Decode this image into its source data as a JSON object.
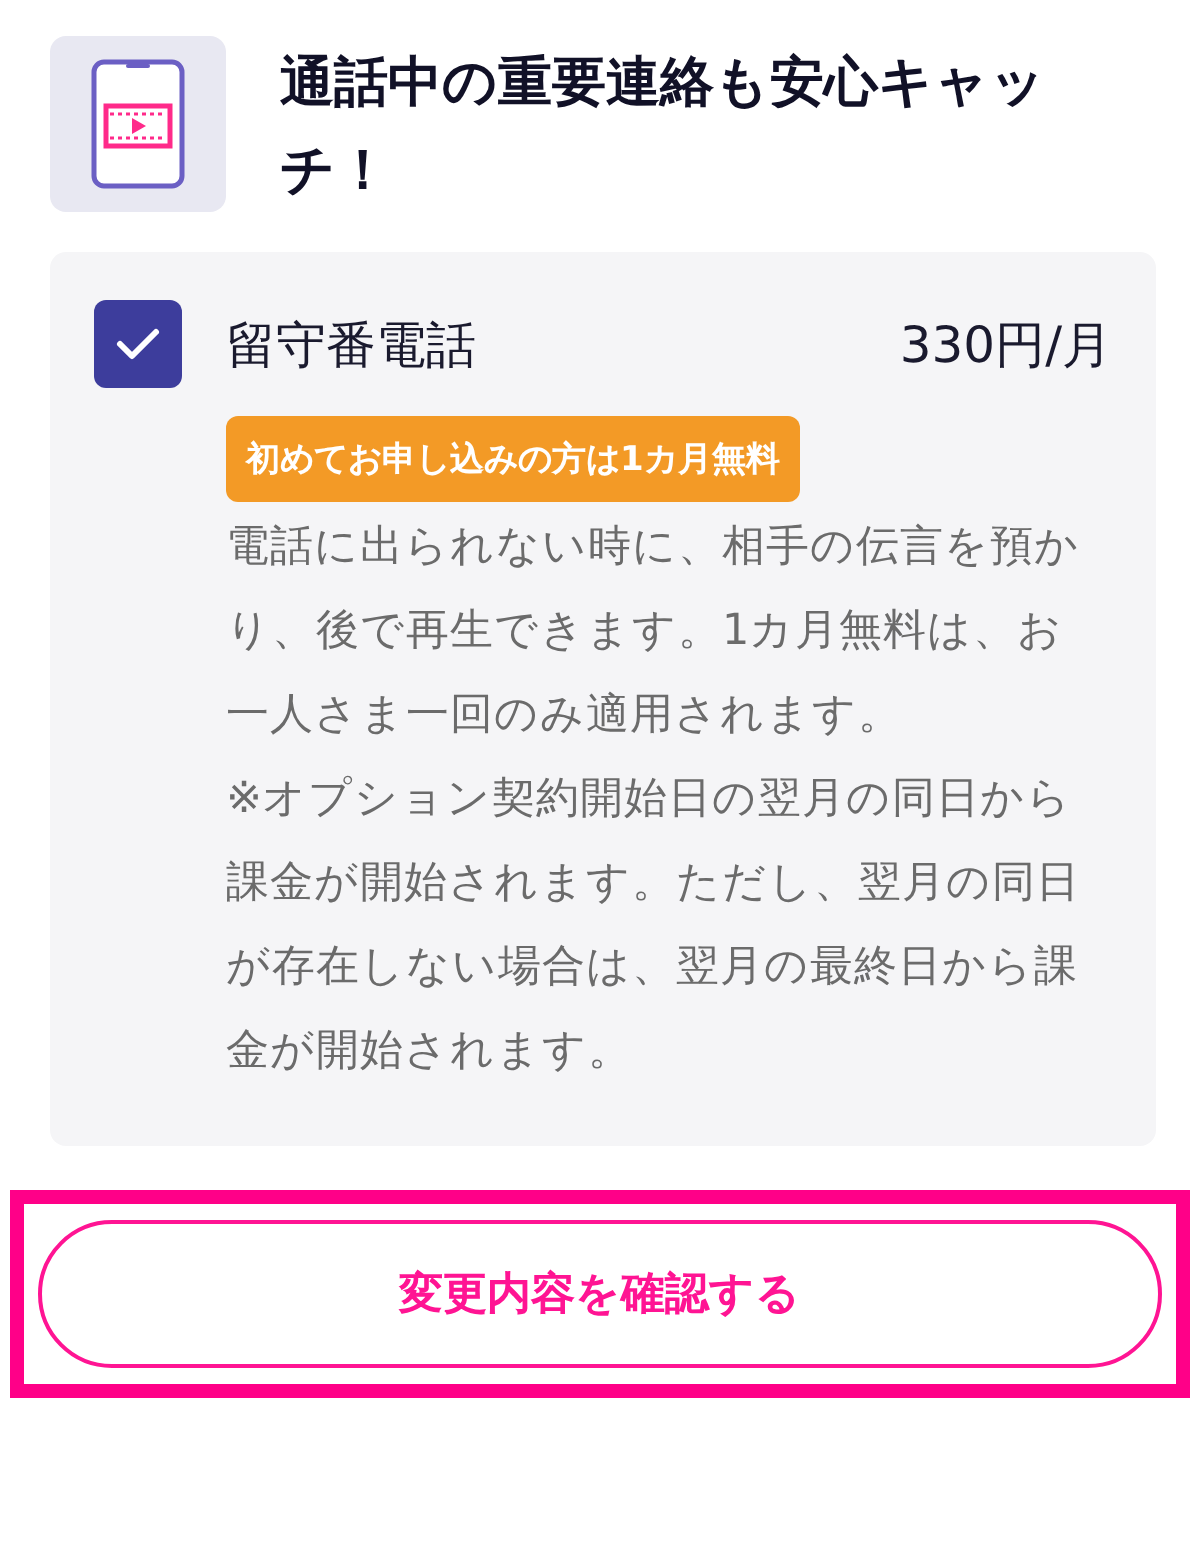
{
  "header": {
    "title": "通話中の重要連絡も安心キャッチ！"
  },
  "option": {
    "checked": true,
    "name": "留守番電話",
    "price": "330円/月",
    "badge": "初めてお申し込みの方は1カ月無料",
    "paragraphs": [
      "電話に出られない時に、相手の伝言を預かり、後で再生できます。1カ月無料は、お一人さま一回のみ適用されます。",
      "※オプション契約開始日の翌月の同日から課金が開始されます。ただし、翌月の同日が存在しない場合は、翌月の最終日から課金が開始されます。"
    ]
  },
  "confirm_button": {
    "label": "変更内容を確認する"
  }
}
